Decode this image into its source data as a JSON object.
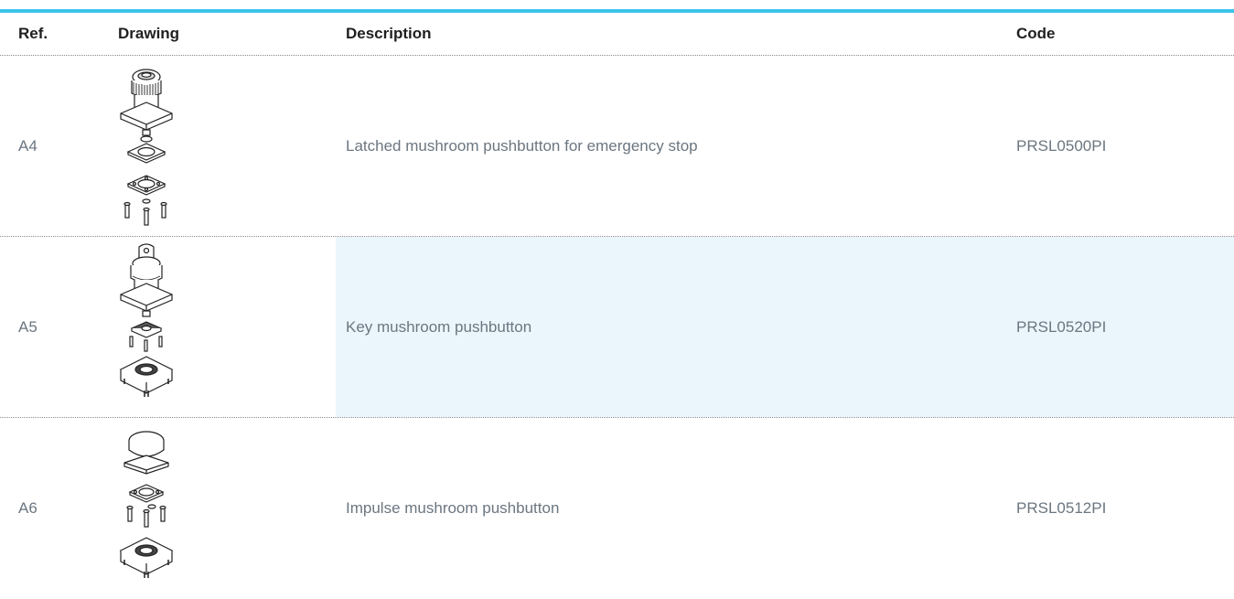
{
  "table": {
    "columns": {
      "ref": "Ref.",
      "drawing": "Drawing",
      "description": "Description",
      "code": "Code"
    },
    "rows": [
      {
        "ref": "A4",
        "drawing_icon": "latched-mushroom-pushbutton-exploded-drawing",
        "description": "Latched mushroom pushbutton for emergency stop",
        "code": "PRSL0500PI",
        "highlighted": false
      },
      {
        "ref": "A5",
        "drawing_icon": "key-mushroom-pushbutton-exploded-drawing",
        "description": "Key mushroom pushbutton",
        "code": "PRSL0520PI",
        "highlighted": true
      },
      {
        "ref": "A6",
        "drawing_icon": "impulse-mushroom-pushbutton-exploded-drawing",
        "description": "Impulse mushroom pushbutton",
        "code": "PRSL0512PI",
        "highlighted": false
      }
    ],
    "colors": {
      "header_rule": "#3cc3e8",
      "row_highlight": "#eaf6fc",
      "body_text": "#6b7680",
      "header_text": "#1f1f1f"
    }
  }
}
